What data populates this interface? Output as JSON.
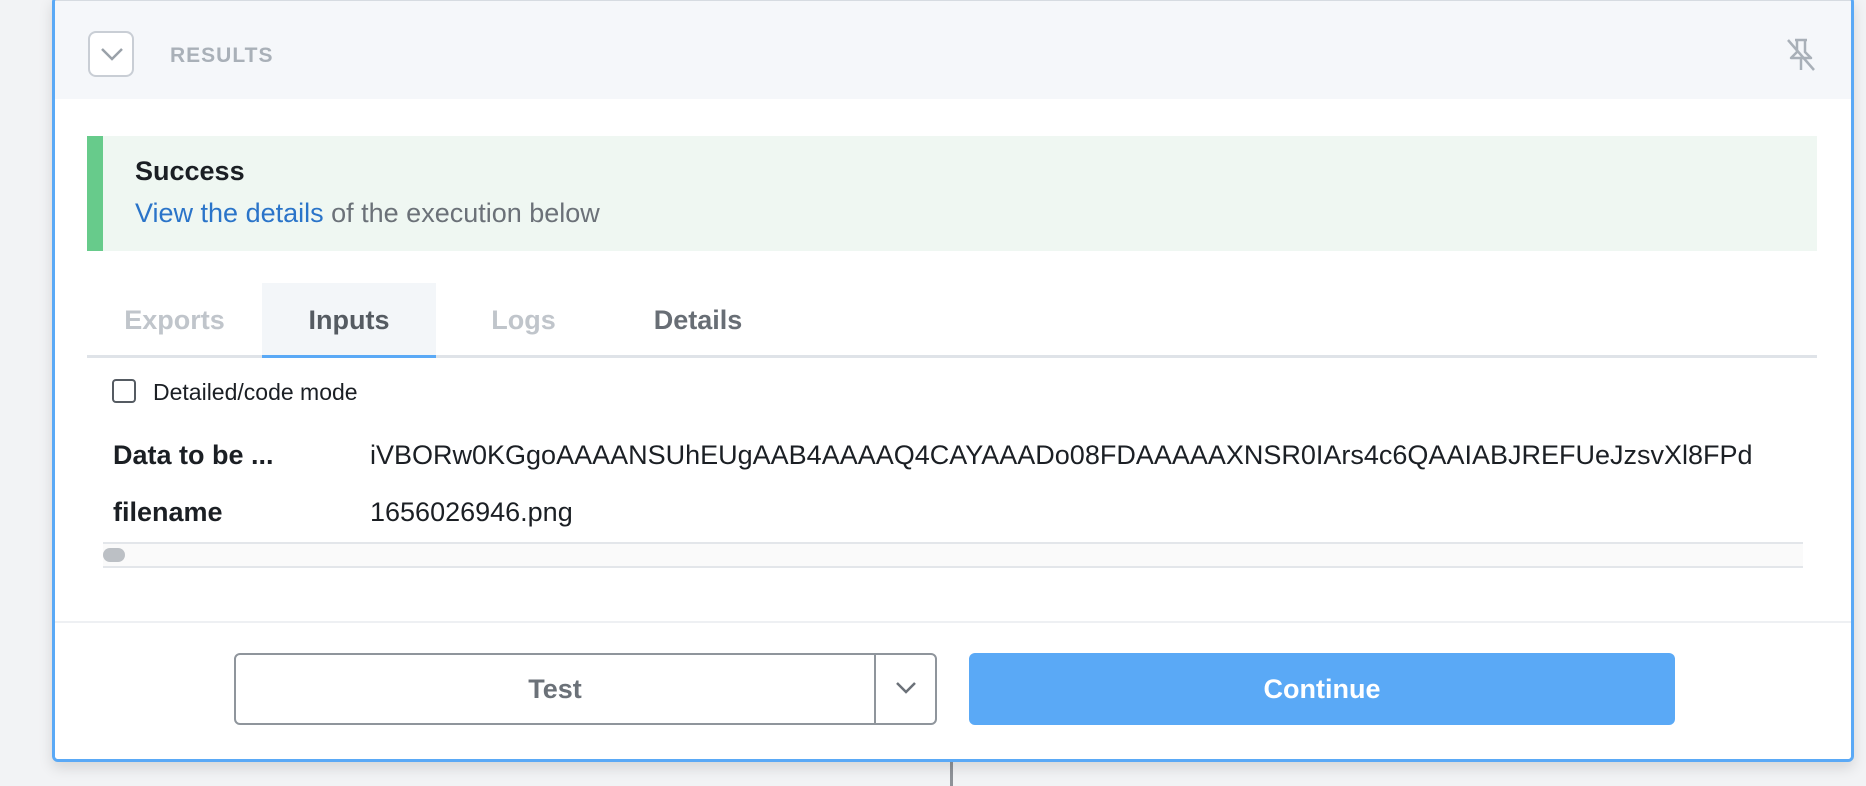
{
  "header": {
    "title": "RESULTS",
    "collapse_icon": "chevron-down-icon",
    "pin_icon": "unpin-icon"
  },
  "status": {
    "title": "Success",
    "link_text": "View the details",
    "rest_text": " of the execution below",
    "accent_color": "#67cb8b"
  },
  "tabs": [
    {
      "label": "Exports",
      "state": "disabled"
    },
    {
      "label": "Inputs",
      "state": "active"
    },
    {
      "label": "Logs",
      "state": "disabled"
    },
    {
      "label": "Details",
      "state": "normal"
    }
  ],
  "mode": {
    "label": "Detailed/code mode",
    "checked": false
  },
  "inputs": [
    {
      "key": "Data to be ...",
      "value": "iVBORw0KGgoAAAANSUhEUgAAB4AAAAQ4CAYAAADo08FDAAAAAXNSR0IArs4c6QAAIABJREFUeJzsvXl8FPd"
    },
    {
      "key": "filename",
      "value": "1656026946.png"
    }
  ],
  "footer": {
    "test_label": "Test",
    "continue_label": "Continue",
    "primary_color": "#5aa9f6"
  }
}
